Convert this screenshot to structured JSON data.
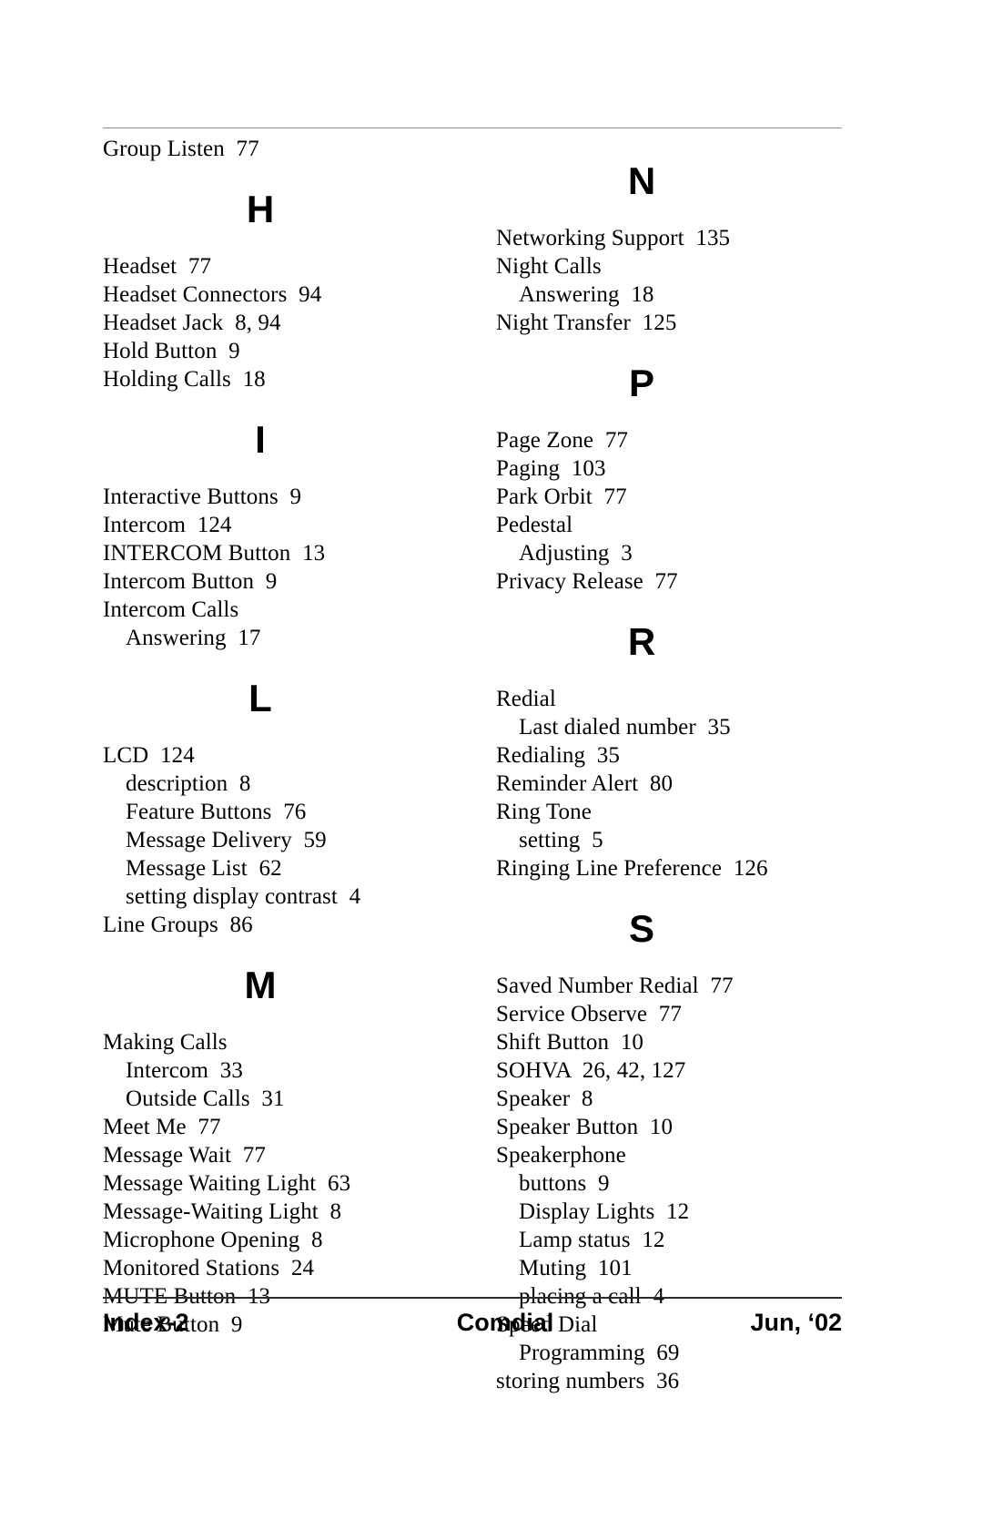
{
  "document": {
    "type": "book-index-page"
  },
  "columns": [
    {
      "name": "left-column",
      "blocks": [
        {
          "letter": null,
          "entries": [
            {
              "text": "Group Listen  77",
              "level": 0
            }
          ]
        },
        {
          "letter": "H",
          "entries": [
            {
              "text": "Headset  77",
              "level": 0
            },
            {
              "text": "Headset Connectors  94",
              "level": 0
            },
            {
              "text": "Headset Jack  8, 94",
              "level": 0
            },
            {
              "text": "Hold Button  9",
              "level": 0
            },
            {
              "text": "Holding Calls  18",
              "level": 0
            }
          ]
        },
        {
          "letter": "I",
          "entries": [
            {
              "text": "Interactive Buttons  9",
              "level": 0
            },
            {
              "text": "Intercom  124",
              "level": 0
            },
            {
              "text": "INTERCOM Button  13",
              "level": 0
            },
            {
              "text": "Intercom Button  9",
              "level": 0
            },
            {
              "text": "Intercom Calls",
              "level": 0
            },
            {
              "text": "Answering  17",
              "level": 1
            }
          ]
        },
        {
          "letter": "L",
          "entries": [
            {
              "text": "LCD  124",
              "level": 0
            },
            {
              "text": "description  8",
              "level": 1
            },
            {
              "text": "Feature Buttons  76",
              "level": 1
            },
            {
              "text": "Message Delivery  59",
              "level": 1
            },
            {
              "text": "Message List  62",
              "level": 1
            },
            {
              "text": "setting display contrast  4",
              "level": 1
            },
            {
              "text": "Line Groups  86",
              "level": 0
            }
          ]
        },
        {
          "letter": "M",
          "entries": [
            {
              "text": "Making Calls",
              "level": 0
            },
            {
              "text": "Intercom  33",
              "level": 1
            },
            {
              "text": "Outside Calls  31",
              "level": 1
            },
            {
              "text": "Meet Me  77",
              "level": 0
            },
            {
              "text": "Message Wait  77",
              "level": 0
            },
            {
              "text": "Message Waiting Light  63",
              "level": 0
            },
            {
              "text": "Message-Waiting Light  8",
              "level": 0
            },
            {
              "text": "Microphone Opening  8",
              "level": 0
            },
            {
              "text": "Monitored Stations  24",
              "level": 0
            },
            {
              "text": "MUTE Button  13",
              "level": 0
            },
            {
              "text": "Mute Button  9",
              "level": 0
            }
          ]
        }
      ]
    },
    {
      "name": "right-column",
      "blocks": [
        {
          "letter": "N",
          "entries": [
            {
              "text": "Networking Support  135",
              "level": 0
            },
            {
              "text": "Night Calls",
              "level": 0
            },
            {
              "text": "Answering  18",
              "level": 1
            },
            {
              "text": "Night Transfer  125",
              "level": 0
            }
          ]
        },
        {
          "letter": "P",
          "entries": [
            {
              "text": "Page Zone  77",
              "level": 0
            },
            {
              "text": "Paging  103",
              "level": 0
            },
            {
              "text": "Park Orbit  77",
              "level": 0
            },
            {
              "text": "Pedestal",
              "level": 0
            },
            {
              "text": "Adjusting  3",
              "level": 1
            },
            {
              "text": "Privacy Release  77",
              "level": 0
            }
          ]
        },
        {
          "letter": "R",
          "entries": [
            {
              "text": "Redial",
              "level": 0
            },
            {
              "text": "Last dialed number  35",
              "level": 1
            },
            {
              "text": "Redialing  35",
              "level": 0
            },
            {
              "text": "Reminder Alert  80",
              "level": 0
            },
            {
              "text": "Ring Tone",
              "level": 0
            },
            {
              "text": "setting  5",
              "level": 1
            },
            {
              "text": "Ringing Line Preference  126",
              "level": 0
            }
          ]
        },
        {
          "letter": "S",
          "entries": [
            {
              "text": "Saved Number Redial  77",
              "level": 0
            },
            {
              "text": "Service Observe  77",
              "level": 0
            },
            {
              "text": "Shift Button  10",
              "level": 0
            },
            {
              "text": "SOHVA  26, 42, 127",
              "level": 0
            },
            {
              "text": "Speaker  8",
              "level": 0
            },
            {
              "text": "Speaker Button  10",
              "level": 0
            },
            {
              "text": "Speakerphone",
              "level": 0
            },
            {
              "text": "buttons  9",
              "level": 1
            },
            {
              "text": "Display Lights  12",
              "level": 1
            },
            {
              "text": "Lamp status  12",
              "level": 1
            },
            {
              "text": "Muting  101",
              "level": 1
            },
            {
              "text": "placing a call  4",
              "level": 1
            },
            {
              "text": "Speed Dial",
              "level": 0
            },
            {
              "text": "Programming  69",
              "level": 1
            },
            {
              "text": "storing numbers  36",
              "level": 0
            }
          ]
        }
      ]
    }
  ],
  "footer": {
    "left": "Index-2",
    "center": "Comdial",
    "right": "Jun, ‘02"
  }
}
